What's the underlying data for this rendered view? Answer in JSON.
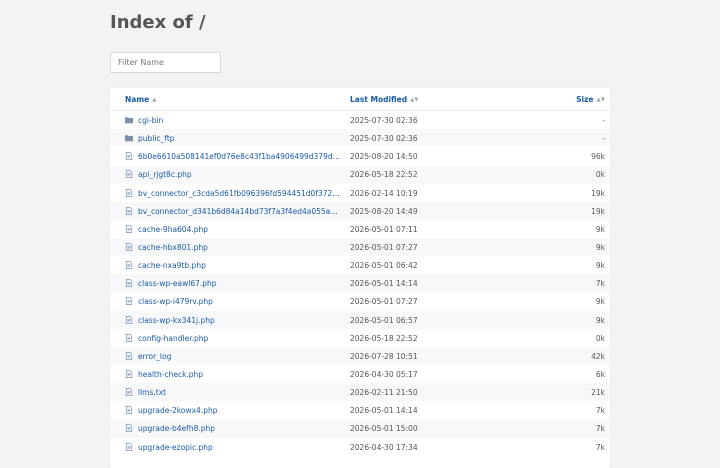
{
  "title": "Index of /",
  "filter": {
    "placeholder": "Filter Name"
  },
  "columns": {
    "name": "Name",
    "modified": "Last Modified",
    "size": "Size"
  },
  "sort_indicator": "▲",
  "sort_indicator_both": "▲▼",
  "rows": [
    {
      "name": "cgi-bin",
      "modified": "2025-07-30 02:36",
      "size": "-",
      "icon": "folder-icon"
    },
    {
      "name": "public_ftp",
      "modified": "2025-07-30 02:36",
      "size": "-",
      "icon": "folder-icon"
    },
    {
      "name": "6b0e6610a508141ef0d76e8c43f1ba4906499d379dc2a...",
      "modified": "2025-08-20 14:50",
      "size": "96k",
      "icon": "file-icon"
    },
    {
      "name": "api_rjgt8c.php",
      "modified": "2026-05-18 22:52",
      "size": "0k",
      "icon": "file-icon"
    },
    {
      "name": "bv_connector_c3cda5d61fb096396fd594451d0f3728.php",
      "modified": "2026-02-14 10:19",
      "size": "19k",
      "icon": "file-icon"
    },
    {
      "name": "bv_connector_d341b6d84a14bd73f7a3f4ed4a055a0a.p...",
      "modified": "2025-08-20 14:49",
      "size": "19k",
      "icon": "file-icon"
    },
    {
      "name": "cache-9ha604.php",
      "modified": "2026-05-01 07:11",
      "size": "9k",
      "icon": "file-icon"
    },
    {
      "name": "cache-hbx801.php",
      "modified": "2026-05-01 07:27",
      "size": "9k",
      "icon": "file-icon"
    },
    {
      "name": "cache-nxa9tb.php",
      "modified": "2026-05-01 06:42",
      "size": "9k",
      "icon": "file-icon"
    },
    {
      "name": "class-wp-eawl67.php",
      "modified": "2026-05-01 14:14",
      "size": "7k",
      "icon": "file-icon"
    },
    {
      "name": "class-wp-i479rv.php",
      "modified": "2026-05-01 07:27",
      "size": "9k",
      "icon": "file-icon"
    },
    {
      "name": "class-wp-kx341j.php",
      "modified": "2026-05-01 06:57",
      "size": "9k",
      "icon": "file-icon"
    },
    {
      "name": "config-handler.php",
      "modified": "2026-05-18 22:52",
      "size": "0k",
      "icon": "file-icon"
    },
    {
      "name": "error_log",
      "modified": "2026-07-28 10:51",
      "size": "42k",
      "icon": "file-icon"
    },
    {
      "name": "health-check.php",
      "modified": "2026-04-30 05:17",
      "size": "6k",
      "icon": "file-icon"
    },
    {
      "name": "llms.txt",
      "modified": "2026-02-11 21:50",
      "size": "21k",
      "icon": "file-icon"
    },
    {
      "name": "upgrade-2kowx4.php",
      "modified": "2026-05-01 14:14",
      "size": "7k",
      "icon": "file-icon"
    },
    {
      "name": "upgrade-b4efh8.php",
      "modified": "2026-05-01 15:00",
      "size": "7k",
      "icon": "file-icon"
    },
    {
      "name": "upgrade-ezopic.php",
      "modified": "2026-04-30 17:34",
      "size": "7k",
      "icon": "file-icon"
    }
  ]
}
